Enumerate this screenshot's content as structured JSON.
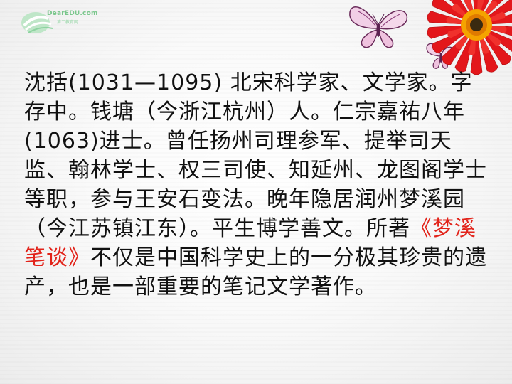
{
  "logo": {
    "brand": "DearEDU.com",
    "subtitle": "第二教育网",
    "icon": "leaf-swirl-logo-icon"
  },
  "decorations": {
    "flower": "red-gerbera-flower-icon",
    "butterfly_large": "butterfly-icon",
    "butterfly_small": "butterfly-icon"
  },
  "text": {
    "part1": "沈括(1031—1095) 北宋科学家、文学家。字存中。钱塘（今浙江杭州）人。仁宗嘉祐八年(1063)进士。曾任扬州司理参军、提举司天监、翰林学士、权三司使、知延州、龙图阁学士等职，参与王安石变法。晚年隐居润州梦溪园（今江苏镇江东）。平生博学善文。所著",
    "open_quote": "《",
    "book_title": "梦溪笔谈",
    "close_quote": "》",
    "part2": "不仅是中国科学史上的一分极其珍贵的遗产，也是一部重要的笔记文学著作。"
  },
  "colors": {
    "highlight": "#e2231a",
    "text": "#111111",
    "logo_green": "#79c68b"
  }
}
